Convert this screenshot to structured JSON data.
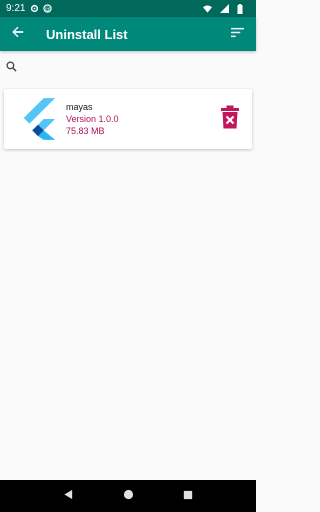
{
  "status_bar": {
    "time": "9:21"
  },
  "app_bar": {
    "title": "Uninstall List"
  },
  "search": {
    "placeholder": "",
    "value": ""
  },
  "apps": [
    {
      "name": "mayas",
      "version": "Version 1.0.0",
      "size": "75.83 MB"
    }
  ],
  "colors": {
    "status_bar": "#00695c",
    "app_bar": "#00897b",
    "accent": "#ad1457",
    "delete": "#c2185b"
  },
  "icons": [
    "back-arrow-icon",
    "sort-icon",
    "search-icon",
    "flutter-logo-icon",
    "delete-icon"
  ]
}
